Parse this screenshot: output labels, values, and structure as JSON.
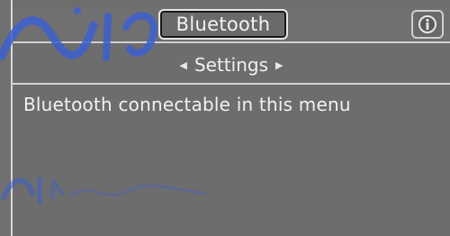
{
  "header": {
    "active_tab": "Bluetooth"
  },
  "icons": {
    "info": "info-icon",
    "nav_left": "arrow-left-icon",
    "nav_right": "arrow-right-icon"
  },
  "nav": {
    "label": "Settings"
  },
  "main": {
    "message": "Bluetooth connectable in this menu"
  },
  "watermark": {
    "logo_text": "ايران خودرو",
    "bottom_text": "عصر شماره ورژن ۸۵"
  },
  "colors": {
    "screen_bg": "#707070",
    "text": "#f2f2f2",
    "border_light": "#d4d4d4",
    "tab_outline_dark": "#1a1a1a",
    "watermark": "#3c5fd0"
  }
}
